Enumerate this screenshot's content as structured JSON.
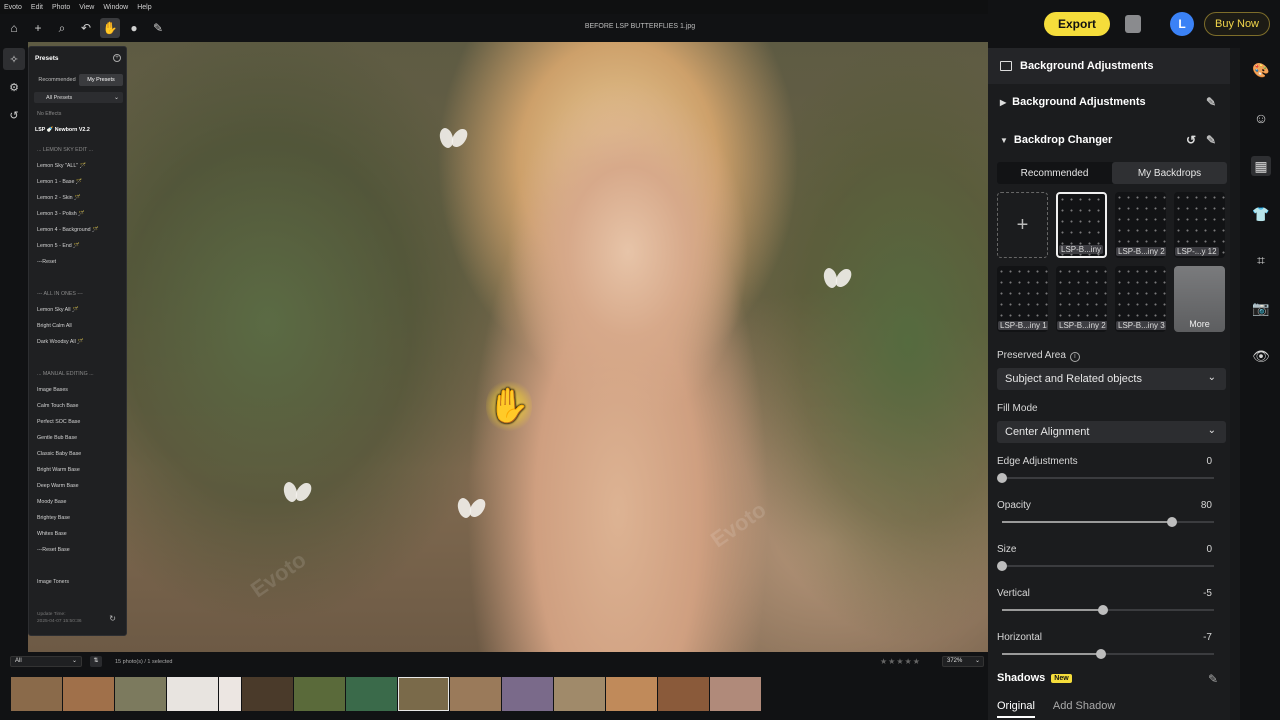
{
  "menubar": {
    "items": [
      "Evoto",
      "Edit",
      "Photo",
      "View",
      "Window",
      "Help"
    ]
  },
  "toolbar": {
    "file_title": "BEFORE LSP BUTTERFLIES 1.jpg"
  },
  "topright": {
    "export_label": "Export",
    "avatar_initial": "L",
    "buy_label": "Buy Now"
  },
  "presets": {
    "title": "Presets",
    "tabs": [
      "Recommended",
      "My Presets"
    ],
    "filter": "All Presets",
    "no_effects": "No Effects",
    "group_title": "LSP 🍼 Newborn V2.2",
    "items": [
      "... LEMON SKY EDIT ...",
      "Lemon Sky \"ALL\" 🪄",
      "Lemon 1 - Base 🪄",
      "Lemon 2 - Skin 🪄",
      "Lemon 3 - Polish 🪄",
      "Lemon 4 - Background 🪄",
      "Lemon 5 - End 🪄",
      "---Reset",
      "--- ALL IN ONES ---",
      "Lemon Sky All 🪄",
      "Bright Calm All",
      "Dark Woodsy All 🪄",
      "... MANUAL EDITING ...",
      "Image Bases",
      "Calm Touch Base",
      "Perfect SOC Base",
      "Gentle Bub Base",
      "Classic Baby Base",
      "Bright Warm Base",
      "Deep Warm Base",
      "Moody Base",
      "Brightey Base",
      "Whites Base",
      "---Reset Base",
      "Image Toners"
    ],
    "footer_label": "Update Time:",
    "footer_time": "2025-04-07 15:50:36"
  },
  "filmstrip": {
    "filter": "All",
    "count": "15 photo(s) / 1 selected",
    "stars": "★★★★★",
    "zoom": "372%",
    "thumb_colors": [
      "#8a6a4a",
      "#a0704a",
      "#7c7a5e",
      "#e8e4e0",
      "#ece6e2",
      "#4a3a2a",
      "#5a6a3a",
      "#3a6a4a",
      "#7a6a4a",
      "#9a7a5a",
      "#7a6a8a",
      "#a08a6a",
      "#c08a5a",
      "#8a5a3a",
      "#b08a7a"
    ]
  },
  "right_panel": {
    "header": "Background Adjustments",
    "section1": "Background Adjustments",
    "section2": "Backdrop Changer",
    "tabs": [
      "Recommended",
      "My Backdrops"
    ],
    "backdrops": [
      "LSP-B...iny",
      "LSP-B...iny 2",
      "LSP-...y 12",
      "LSP-B...iny 1",
      "LSP-B...iny 2",
      "LSP-B...iny 3"
    ],
    "more_label": "More",
    "preserved_area_label": "Preserved Area",
    "preserved_area_value": "Subject and Related objects",
    "fill_mode_label": "Fill Mode",
    "fill_mode_value": "Center Alignment",
    "sliders": [
      {
        "label": "Edge Adjustments",
        "value": "0",
        "fraction": 0.0
      },
      {
        "label": "Opacity",
        "value": "80",
        "fraction": 0.8
      },
      {
        "label": "Size",
        "value": "0",
        "fraction": 0.0
      },
      {
        "label": "Vertical",
        "value": "-5",
        "fraction": 0.475
      },
      {
        "label": "Horizontal",
        "value": "-7",
        "fraction": 0.465
      }
    ],
    "shadows_label": "Shadows",
    "new_badge": "New",
    "shadow_tabs": [
      "Original",
      "Add Shadow"
    ]
  },
  "colors": {
    "accent": "#f5dd3b",
    "avatar": "#3b82f6",
    "panel": "#1b1c1e"
  }
}
